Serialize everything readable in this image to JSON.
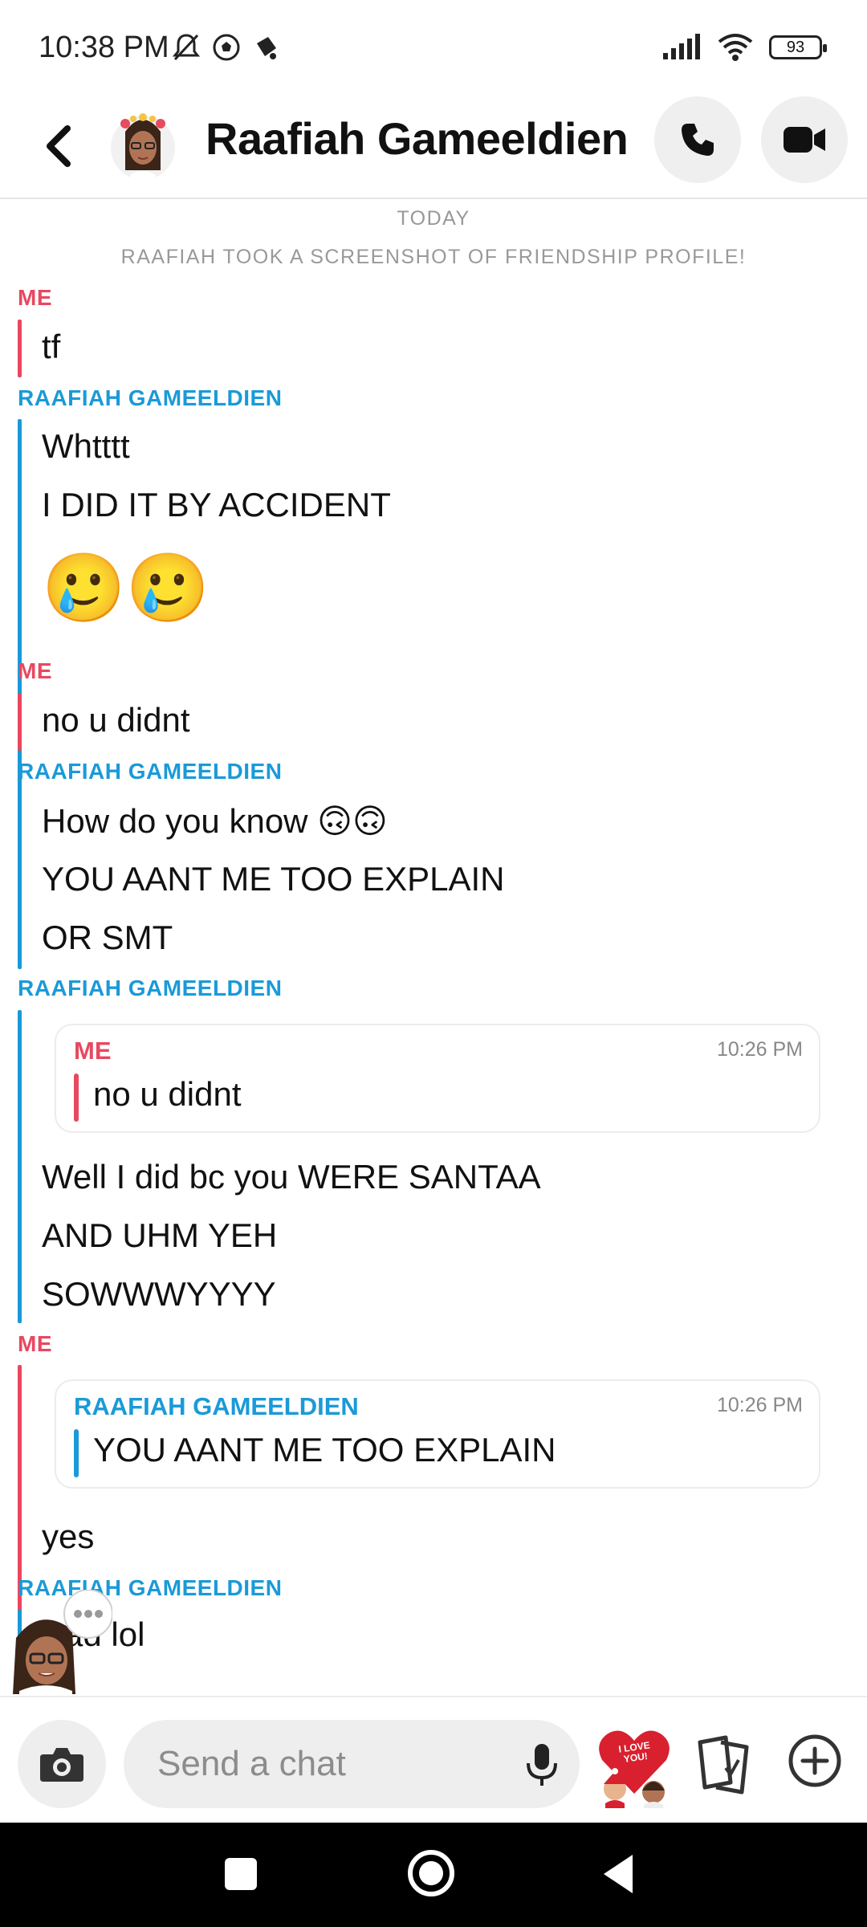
{
  "status_bar": {
    "time": "10:38 PM",
    "battery": "93",
    "icons_left": [
      "bell-off-icon",
      "soccer-ball-icon",
      "notification-icon"
    ],
    "icons_right": [
      "signal-icon",
      "wifi-icon",
      "battery-icon"
    ]
  },
  "header": {
    "contact_name": "Raafiah Gameeldien",
    "icons": [
      "back-arrow-icon",
      "phone-icon",
      "video-camera-icon"
    ]
  },
  "chat": {
    "day_label": "TODAY",
    "system_notice": "RAAFIAH TOOK A SCREENSHOT OF FRIENDSHIP PROFILE!",
    "sender_me": "ME",
    "sender_them": "RAAFIAH GAMEELDIEN",
    "messages": {
      "m1": "tf",
      "m2": "Whtttt",
      "m3": "I DID IT BY ACCIDENT",
      "m4_emoji": "🥲🥲",
      "m5": "no u didnt",
      "m6": "How do you know 🙃🙃",
      "m7": "YOU AANT ME TOO EXPLAIN",
      "m8": "OR SMT",
      "m9": "Well I did bc you WERE SANTAA",
      "m10": "AND UHM YEH",
      "m11": "SOWWWYYYY",
      "m12": "yes",
      "m13": "Sad lol"
    },
    "quote1": {
      "sender": "ME",
      "time": "10:26 PM",
      "text": "no u didnt"
    },
    "quote2": {
      "sender": "RAAFIAH GAMEELDIEN",
      "time": "10:26 PM",
      "text": "YOU AANT ME TOO EXPLAIN"
    }
  },
  "input_bar": {
    "placeholder": "Send a chat",
    "sticker_text": "I LOVE YOU!",
    "icons": [
      "camera-icon",
      "microphone-icon",
      "cards-icon",
      "plus-circle-icon"
    ]
  },
  "colors": {
    "me": "#e8485f",
    "them": "#1a9ad8",
    "system_text": "#999999"
  }
}
